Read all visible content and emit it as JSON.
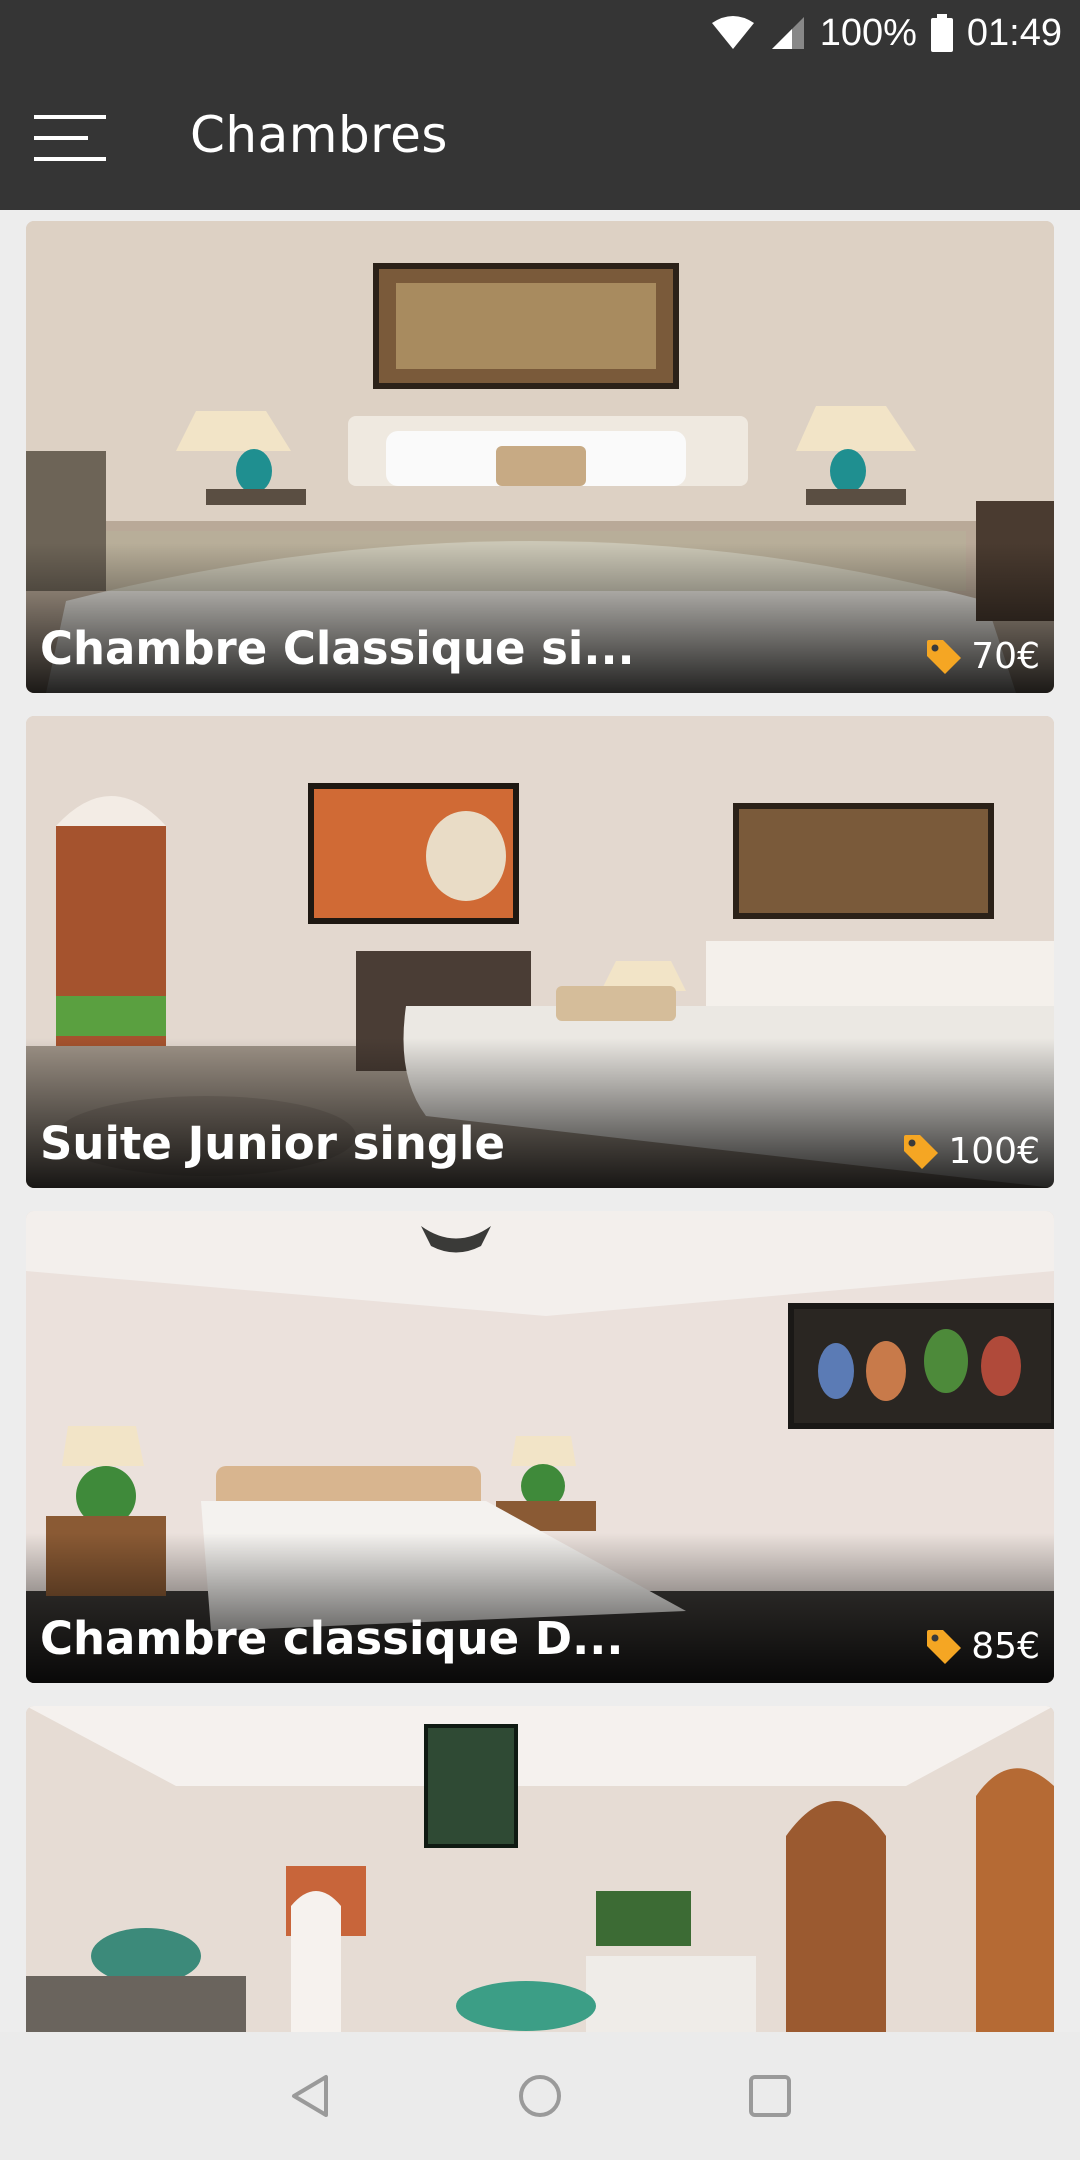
{
  "status_bar": {
    "battery": "100%",
    "time": "01:49"
  },
  "app_bar": {
    "title": "Chambres",
    "menu_icon": "hamburger-menu-icon"
  },
  "rooms": [
    {
      "name": "Chambre Classique si...",
      "price": "70€",
      "price_icon": "price-tag-icon"
    },
    {
      "name": "Suite Junior single",
      "price": "100€",
      "price_icon": "price-tag-icon"
    },
    {
      "name": "Chambre classique D...",
      "price": "85€",
      "price_icon": "price-tag-icon"
    },
    {
      "name": "",
      "price": "",
      "price_icon": "price-tag-icon"
    }
  ],
  "nav_bar": {
    "back_icon": "back-icon",
    "home_icon": "home-icon",
    "recents_icon": "recents-icon"
  },
  "colors": {
    "app_bar": "#353535",
    "price_tag": "#f5a623",
    "background": "#ededed"
  }
}
